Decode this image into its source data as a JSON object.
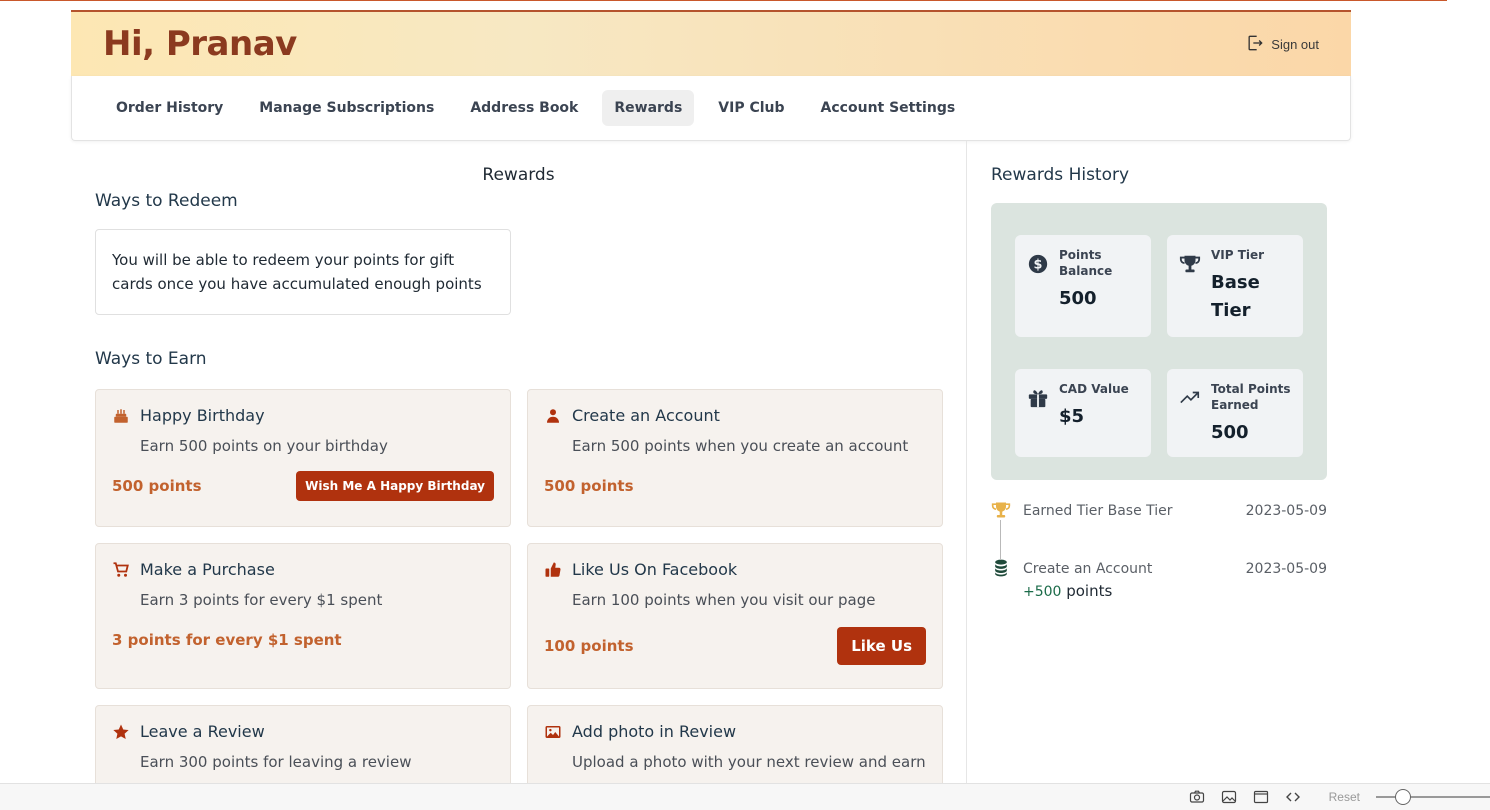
{
  "header": {
    "greeting": "Hi, Pranav",
    "signout_label": "Sign out"
  },
  "nav": {
    "items": [
      {
        "label": "Order History"
      },
      {
        "label": "Manage Subscriptions"
      },
      {
        "label": "Address Book"
      },
      {
        "label": "Rewards",
        "active": true
      },
      {
        "label": "VIP Club"
      },
      {
        "label": "Account Settings"
      }
    ]
  },
  "main": {
    "title": "Rewards",
    "redeem": {
      "heading": "Ways to Redeem",
      "message": "You will be able to redeem your points for gift cards once you have accumulated enough points"
    },
    "earn": {
      "heading": "Ways to Earn",
      "cards": [
        {
          "icon": "birthday-cake-icon",
          "title": "Happy Birthday",
          "desc": "Earn 500 points on your birthday",
          "points": "500 points",
          "button": "Wish Me A Happy Birthday"
        },
        {
          "icon": "user-icon",
          "title": "Create an Account",
          "desc": "Earn 500 points when you create an account",
          "points": "500 points"
        },
        {
          "icon": "cart-icon",
          "title": "Make a Purchase",
          "desc": "Earn 3 points for every $1 spent",
          "points": "3 points for every $1 spent"
        },
        {
          "icon": "thumbs-up-icon",
          "title": "Like Us On Facebook",
          "desc": "Earn 100 points when you visit our page",
          "points": "100 points",
          "button": "Like Us"
        },
        {
          "icon": "star-icon",
          "title": "Leave a Review",
          "desc": "Earn 300 points for leaving a review"
        },
        {
          "icon": "image-icon",
          "title": "Add photo in Review",
          "desc": "Upload a photo with your next review and earn"
        }
      ]
    }
  },
  "side": {
    "title": "Rewards History",
    "stats": [
      {
        "icon": "dollar-icon",
        "label": "Points Balance",
        "value": "500"
      },
      {
        "icon": "trophy-icon",
        "label": "VIP Tier",
        "value": "Base Tier"
      },
      {
        "icon": "gift-icon",
        "label": "CAD Value",
        "value": "$5"
      },
      {
        "icon": "trend-up-icon",
        "label": "Total Points Earned",
        "value": "500"
      }
    ],
    "history": [
      {
        "icon": "trophy-icon",
        "text": "Earned Tier Base Tier",
        "date": "2023-05-09"
      },
      {
        "icon": "coins-icon",
        "text": "Create an Account",
        "date": "2023-05-09",
        "points_plus": "+500",
        "points_word": "points"
      }
    ]
  },
  "toolbar": {
    "reset_label": "Reset",
    "zoom_fraction": 0.17
  },
  "colors": {
    "accent": "#b0320e",
    "points": "#c2622e",
    "greeting": "#8b3a1f",
    "stats_bg": "#dbe4df"
  }
}
